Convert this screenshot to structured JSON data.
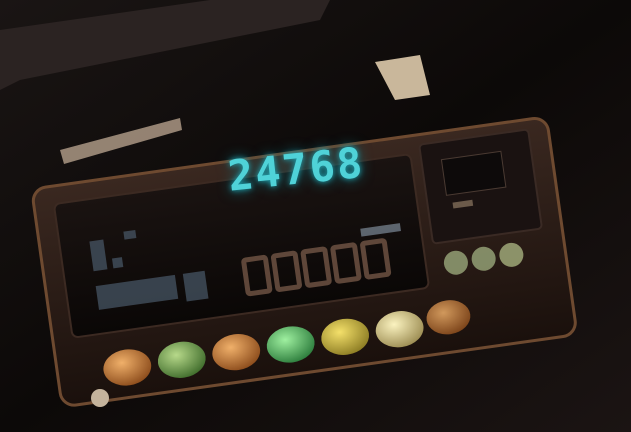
{
  "display": {
    "main_readout": "24768"
  },
  "colors": {
    "readout": "#4fd2d8",
    "dim_segments": "#7a5b4a",
    "body": "#2a1a14",
    "background": "#0d0a09"
  }
}
